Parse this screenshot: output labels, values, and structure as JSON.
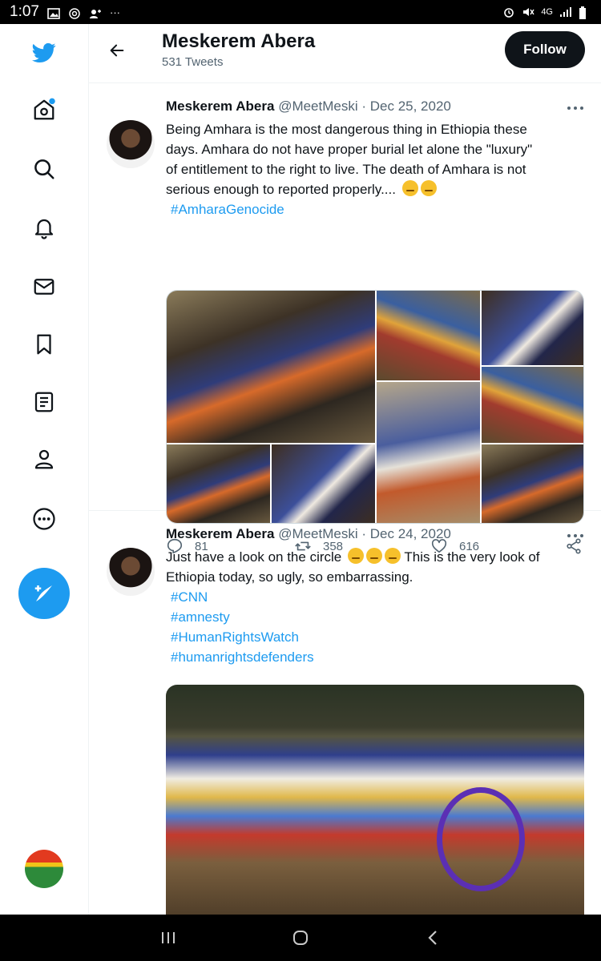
{
  "status_bar": {
    "time": "1:07",
    "network": "4G"
  },
  "nav": {
    "items": [
      "home-icon",
      "search-icon",
      "notifications-icon",
      "messages-icon",
      "bookmarks-icon",
      "lists-icon",
      "profile-icon",
      "more-icon"
    ],
    "compose": "compose-tweet-icon"
  },
  "header": {
    "title": "Meskerem Abera",
    "subtitle": "531 Tweets",
    "follow_label": "Follow"
  },
  "tweets": [
    {
      "name": "Meskerem Abera",
      "handle": "@MeetMeski",
      "sep": " · ",
      "date": "Dec 25, 2020",
      "text_lines": [
        "Being Amhara is the most dangerous thing in Ethiopia these",
        "days. Amhara do not have proper burial let alone the \"luxury\"",
        "of  entitlement to the right to live. The death of Amhara is not",
        "serious enough to  reported properly.... "
      ],
      "hashtags": [
        "#AmharaGenocide"
      ],
      "replies": "81",
      "retweets": "358",
      "likes": "616"
    },
    {
      "name": "Meskerem Abera",
      "handle": "@MeetMeski",
      "sep": " · ",
      "date": "Dec 24, 2020",
      "text_lines": [
        "Just have a look on the circle ",
        " This is the very look of",
        "Ethiopia  today,  so ugly, so embarrassing."
      ],
      "hashtags": [
        "#CNN",
        "#amnesty",
        "#HumanRightsWatch",
        "#humanrightsdefenders"
      ]
    }
  ],
  "colors": {
    "accent": "#1d9bf0",
    "text": "#0f1419",
    "muted": "#536471"
  }
}
